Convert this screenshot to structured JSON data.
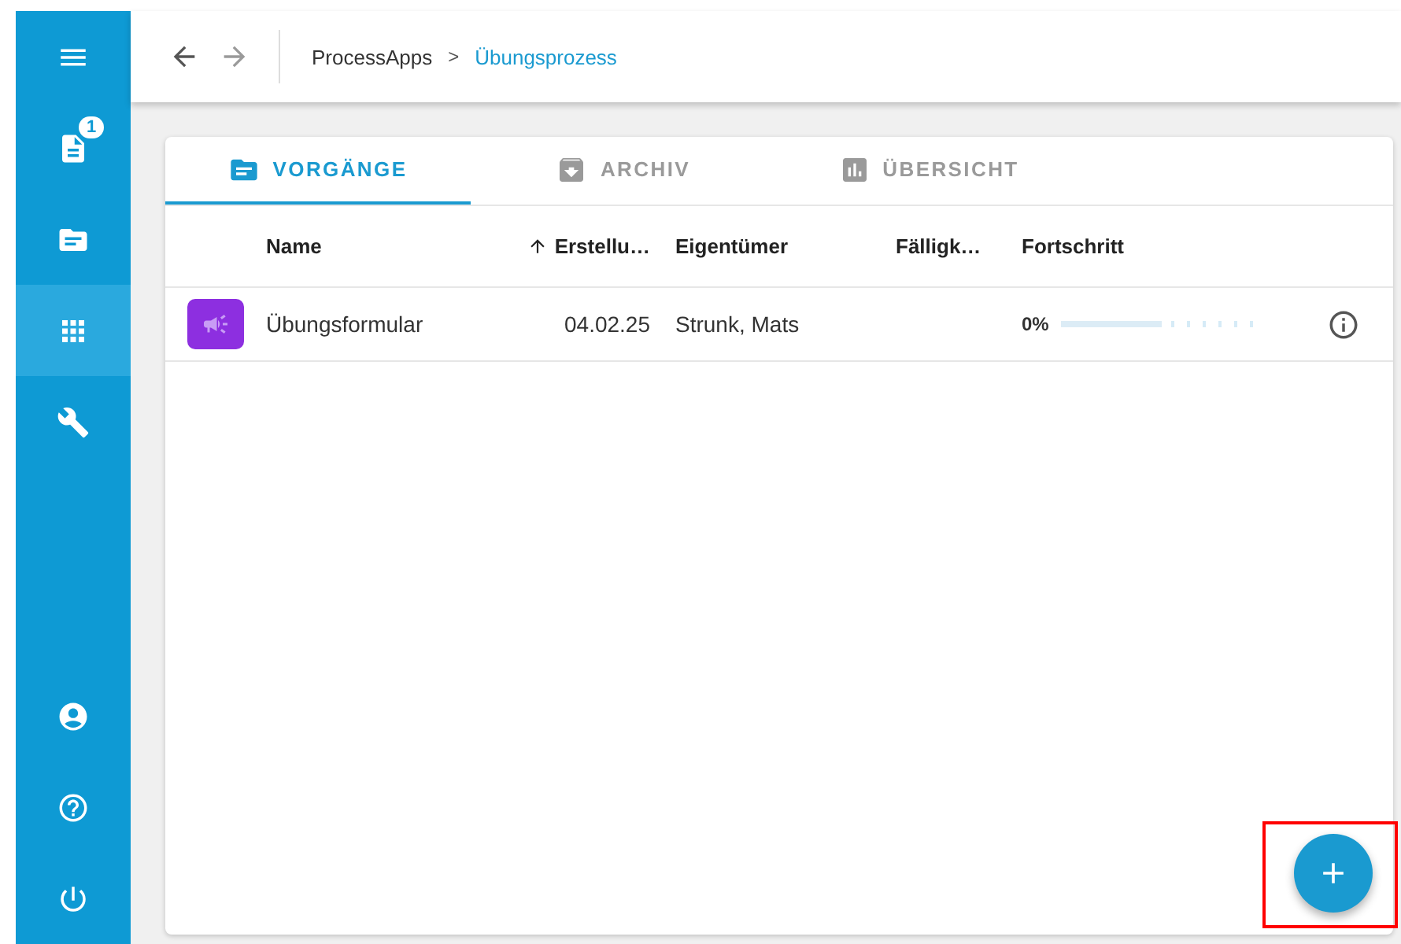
{
  "sidebar": {
    "items": [
      {
        "kind": "menu",
        "selected": false
      },
      {
        "kind": "tasks",
        "selected": false,
        "badge": "1"
      },
      {
        "kind": "folder",
        "selected": false
      },
      {
        "kind": "apps",
        "selected": true
      },
      {
        "kind": "tools",
        "selected": false
      }
    ],
    "bottom_items": [
      {
        "kind": "account",
        "selected": false
      },
      {
        "kind": "help",
        "selected": false
      },
      {
        "kind": "power",
        "selected": false
      }
    ]
  },
  "toolbar": {
    "breadcrumb": [
      {
        "label": "ProcessApps",
        "current": false
      },
      {
        "label": "Übungsprozess",
        "current": true
      }
    ],
    "separator": ">"
  },
  "tabs": [
    {
      "label": "VORGÄNGE",
      "kind": "folder",
      "selected": true
    },
    {
      "label": "ARCHIV",
      "kind": "archive",
      "selected": false
    },
    {
      "label": "ÜBERSICHT",
      "kind": "chart",
      "selected": false
    }
  ],
  "table": {
    "columns": [
      {
        "label": "Name",
        "sorted": false
      },
      {
        "label": "Erstellu…",
        "sorted": true
      },
      {
        "label": "Eigentümer",
        "sorted": false
      },
      {
        "label": "Fälligk…",
        "sorted": false
      },
      {
        "label": "Fortschritt",
        "sorted": false
      }
    ],
    "rows": [
      {
        "name": "Übungsformular",
        "created": "04.02.25",
        "owner": "Strunk, Mats",
        "progress_text": "0%",
        "level": 0
      }
    ]
  },
  "fab": {
    "highlighted": true
  }
}
